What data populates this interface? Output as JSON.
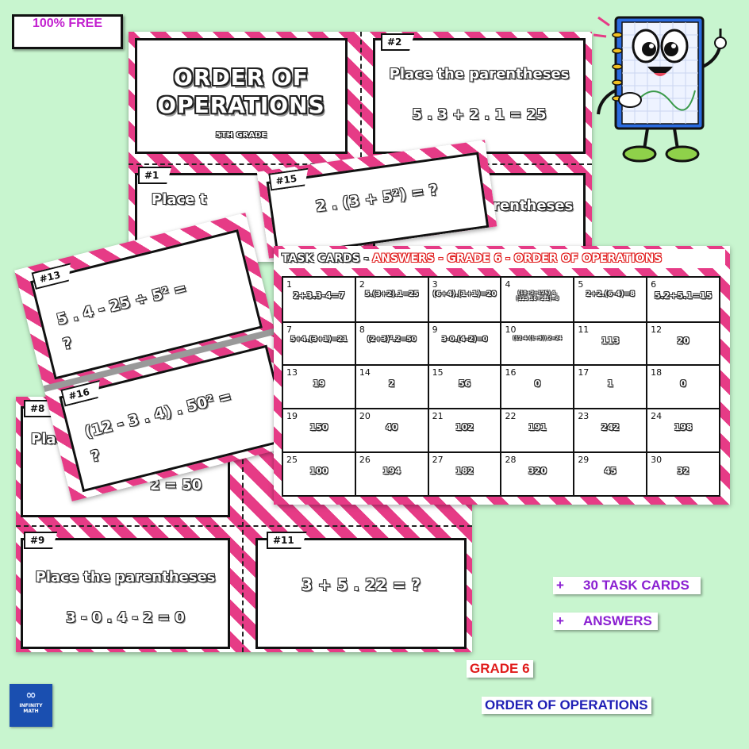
{
  "badge": "100% FREE",
  "top_sheet": {
    "title_line1": "ORDER OF",
    "title_line2": "OPERATIONS",
    "grade_small": "5TH GRADE",
    "card2_tag": "#2",
    "card2_line1": "Place the parentheses",
    "card2_line2": "5 . 3 + 2 . 1 = 25",
    "card1_tag": "#1",
    "card1_text": "Place t",
    "card_right_text": "rentheses"
  },
  "card15": {
    "tag": "#15",
    "expr": "2 . (3 + 5²) = ?"
  },
  "card13": {
    "tag": "#13",
    "line1": "5 . 4 - 25 ÷ 5² =",
    "line2": "?"
  },
  "card16": {
    "tag": "#16",
    "line1": "(12 - 3 . 4) . 50² =",
    "line2": "?"
  },
  "bottom_sheet": {
    "card8_tag": "#8",
    "card8_line1": "Place",
    "card8_line2": "2 +",
    "card8_line2b": "2 = 50",
    "card9_tag": "#9",
    "card9_line1": "Place the parentheses",
    "card9_line2": "3 - 0 . 4 - 2 = 0",
    "card11_tag": "#11",
    "card11_line1": "3 + 5 . 22 = ?"
  },
  "answers": {
    "header_black": "TASK CARDS - ",
    "header_red": "ANSWERS - GRADE 6 - ORDER OF OPERATIONS",
    "cells": [
      {
        "n": "1",
        "v": "2+3.3-4=7"
      },
      {
        "n": "2",
        "v": "5.(3+2).1=25"
      },
      {
        "n": "3",
        "v": "(6+4).(1+1)=20"
      },
      {
        "n": "4",
        "v": "(10+2+125).4.(125.10+2.1)=0"
      },
      {
        "n": "5",
        "v": "2+2.(6-4)=8"
      },
      {
        "n": "6",
        "v": "5.2+5.1=15"
      },
      {
        "n": "7",
        "v": "5+4.(3+1)=21"
      },
      {
        "n": "8",
        "v": "(2+3)².2=50"
      },
      {
        "n": "9",
        "v": "3-0.(4-2)=0"
      },
      {
        "n": "10",
        "v": "(12-4-(1+3)).2=24"
      },
      {
        "n": "11",
        "v": "113"
      },
      {
        "n": "12",
        "v": "20"
      },
      {
        "n": "13",
        "v": "19"
      },
      {
        "n": "14",
        "v": "2"
      },
      {
        "n": "15",
        "v": "56"
      },
      {
        "n": "16",
        "v": "0"
      },
      {
        "n": "17",
        "v": "1"
      },
      {
        "n": "18",
        "v": "0"
      },
      {
        "n": "19",
        "v": "150"
      },
      {
        "n": "20",
        "v": "40"
      },
      {
        "n": "21",
        "v": "102"
      },
      {
        "n": "22",
        "v": "191"
      },
      {
        "n": "23",
        "v": "242"
      },
      {
        "n": "24",
        "v": "198"
      },
      {
        "n": "25",
        "v": "100"
      },
      {
        "n": "26",
        "v": "194"
      },
      {
        "n": "27",
        "v": "182"
      },
      {
        "n": "28",
        "v": "320"
      },
      {
        "n": "29",
        "v": "45"
      },
      {
        "n": "30",
        "v": "32"
      }
    ]
  },
  "bullets": [
    {
      "plus": "+",
      "text": "30 TASK CARDS"
    },
    {
      "plus": "+",
      "text": "ANSWERS"
    }
  ],
  "grade_label": "GRADE 6",
  "topic_label": "ORDER OF OPERATIONS",
  "logo": {
    "line1": "INFINITY",
    "line2": "MATH"
  },
  "colors": {
    "pink": "#e63b86",
    "background": "#c8f5cf",
    "purple": "#8a1fd1",
    "red": "#e01b1b",
    "navy": "#1f1fb5"
  }
}
